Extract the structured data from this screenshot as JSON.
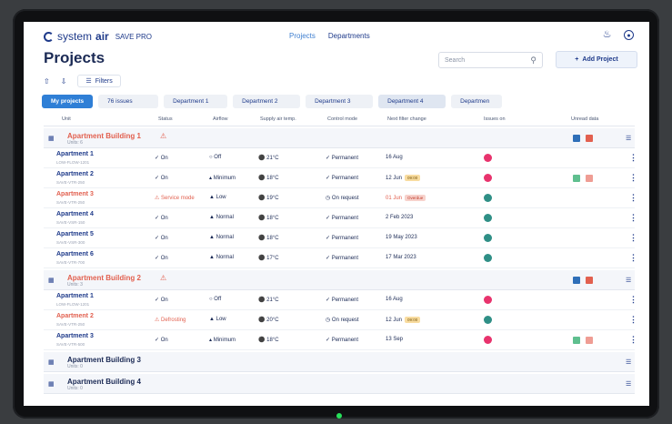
{
  "app": {
    "brand_prefix": "system",
    "brand_name": "air",
    "product": "SAVE PRO"
  },
  "nav": {
    "projects": "Projects",
    "departments": "Departments"
  },
  "page_title": "Projects",
  "search": {
    "placeholder": "Search"
  },
  "add_project_label": "Add Project",
  "filters_label": "Filters",
  "tabs": [
    "My projects",
    "76 issues",
    "Department 1",
    "Department 2",
    "Department 3",
    "Department 4",
    "Departmen"
  ],
  "columns": [
    "Unit",
    "Status",
    "Airflow",
    "Supply air temp.",
    "Control mode",
    "Next filter change",
    "Issues on",
    "Unread data"
  ],
  "groups": [
    {
      "name": "Apartment Building 1",
      "sub": "Units: 6"
    },
    {
      "name": "Apartment Building 2",
      "sub": "Units: 3"
    },
    {
      "name": "Apartment Building 3",
      "sub": "Units: 0"
    },
    {
      "name": "Apartment Building 4",
      "sub": "Units: 0"
    }
  ],
  "rows": [
    {
      "name": "Apartment 1",
      "sub": "LOW-FLOW-1201",
      "status": "On",
      "airflow": "Off",
      "temp": "21°C",
      "mode": "Permanent",
      "filter": "16 Aug",
      "pill": ""
    },
    {
      "name": "Apartment 2",
      "sub": "SAVE-VTR-250",
      "status": "On",
      "airflow": "Minimum",
      "temp": "18°C",
      "mode": "Permanent",
      "filter": "12 Jun",
      "pill": "09:00"
    },
    {
      "name": "Apartment 3",
      "sub": "SAVE-VTR-250",
      "status": "Service mode",
      "airflow": "Low",
      "temp": "19°C",
      "mode": "On request",
      "filter": "01 Jun",
      "pill": "Overdue"
    },
    {
      "name": "Apartment 4",
      "sub": "SAVE-VSR-150",
      "status": "On",
      "airflow": "Normal",
      "temp": "18°C",
      "mode": "Permanent",
      "filter": "2 Feb 2023",
      "pill": ""
    },
    {
      "name": "Apartment 5",
      "sub": "SAVE-VSR-300",
      "status": "On",
      "airflow": "Normal",
      "temp": "18°C",
      "mode": "Permanent",
      "filter": "19 May 2023",
      "pill": ""
    },
    {
      "name": "Apartment 6",
      "sub": "SAVE-VTR-700",
      "status": "On",
      "airflow": "Normal",
      "temp": "17°C",
      "mode": "Permanent",
      "filter": "17 Mar 2023",
      "pill": ""
    },
    {
      "name": "Apartment 1",
      "sub": "LOW-FLOW-1201",
      "status": "On",
      "airflow": "Off",
      "temp": "21°C",
      "mode": "Permanent",
      "filter": "16 Aug",
      "pill": ""
    },
    {
      "name": "Apartment 2",
      "sub": "SAVE-VTR-250",
      "status": "Defrosting",
      "airflow": "Low",
      "temp": "20°C",
      "mode": "On request",
      "filter": "12 Jun",
      "pill": "09:00"
    },
    {
      "name": "Apartment 3",
      "sub": "SAVE-VTR-500",
      "status": "On",
      "airflow": "Minimum",
      "temp": "18°C",
      "mode": "Permanent",
      "filter": "13 Sep",
      "pill": ""
    }
  ],
  "colors": {
    "accent": "#2f7fd6",
    "navy": "#1e3a8a",
    "alarm": "#e2604f",
    "pink": "#e8336d",
    "teal": "#2f8f86"
  }
}
